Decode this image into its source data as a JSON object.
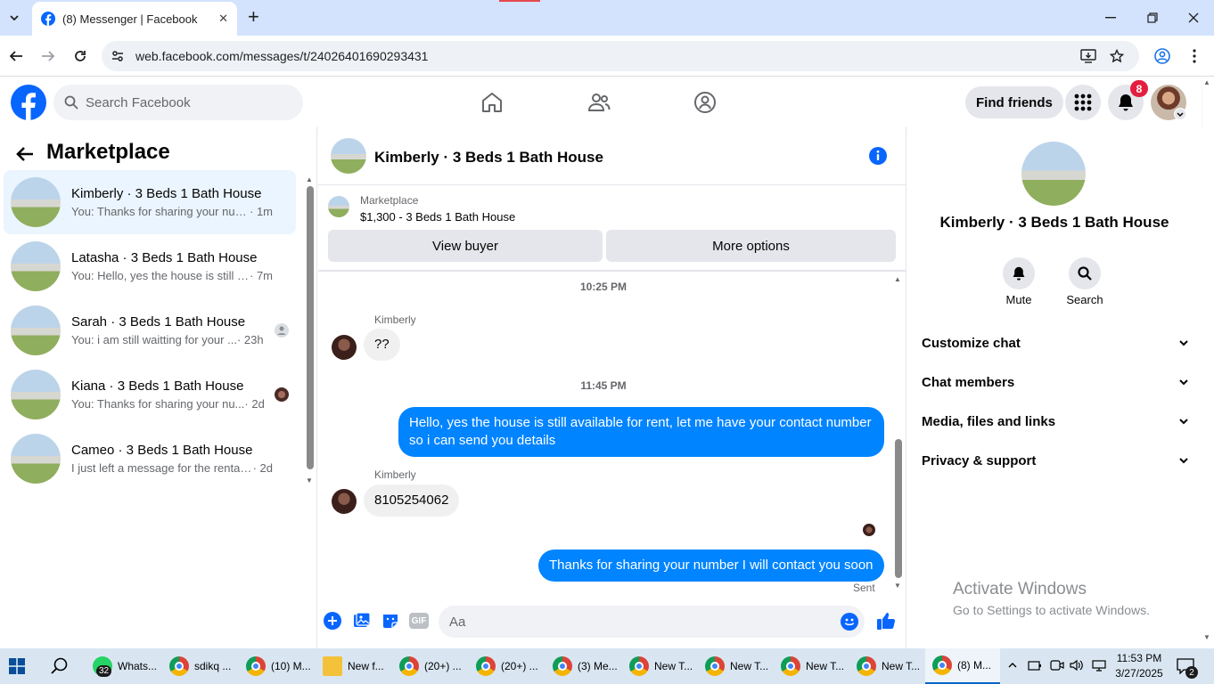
{
  "browser": {
    "tab_title": "(8) Messenger | Facebook",
    "url": "web.facebook.com/messages/t/24026401690293431",
    "new_tab_symbol": "+",
    "close_symbol": "✕"
  },
  "fb": {
    "search_placeholder": "Search Facebook",
    "find_friends": "Find friends",
    "notification_count": "8"
  },
  "left": {
    "title": "Marketplace",
    "conversations": [
      {
        "name": "Kimberly · 3 Beds 1 Bath House",
        "preview": "You: Thanks for sharing your numb...",
        "time": "· 1m"
      },
      {
        "name": "Latasha · 3 Beds 1 Bath House",
        "preview": "You: Hello, yes the house is still av...",
        "time": "· 7m"
      },
      {
        "name": "Sarah · 3 Beds 1 Bath House",
        "preview": "You: i am still waitting for your ...",
        "time": "· 23h"
      },
      {
        "name": "Kiana · 3 Beds 1 Bath House",
        "preview": "You: Thanks for sharing your nu...",
        "time": "· 2d"
      },
      {
        "name": "Cameo · 3 Beds 1 Bath House",
        "preview": "I just left a message for the rental c...",
        "time": "· 2d"
      }
    ]
  },
  "chat": {
    "header_name": "Kimberly · 3 Beds 1 Bath House",
    "listing_label": "Marketplace",
    "listing_title": "$1,300 - 3 Beds 1 Bath House",
    "view_buyer": "View buyer",
    "more_options": "More options",
    "messages": [
      {
        "time": "10:25 PM"
      },
      {
        "sender": "Kimberly",
        "text": "??"
      },
      {
        "time": "11:45 PM"
      },
      {
        "text": "Hello, yes the house is still available for rent, let me have your contact number so i can send you  details"
      },
      {
        "sender": "Kimberly",
        "text": "8105254062"
      },
      {
        "text": "Thanks for sharing your number I will contact you soon"
      }
    ],
    "sent_label": "Sent",
    "composer_placeholder": "Aa",
    "gif_label": "GIF"
  },
  "info": {
    "name": "Kimberly · 3 Beds 1 Bath House",
    "mute": "Mute",
    "search": "Search",
    "sections": [
      "Customize chat",
      "Chat members",
      "Media, files and links",
      "Privacy & support"
    ]
  },
  "watermark": {
    "title": "Activate Windows",
    "subtitle": "Go to Settings to activate Windows."
  },
  "taskbar": {
    "items": [
      "Whats...",
      "sdikq ...",
      "(10) M...",
      "New f...",
      "(20+) ...",
      "(20+) ...",
      "(3) Me...",
      "New T...",
      "New T...",
      "New T...",
      "New T...",
      "(8) M..."
    ],
    "whatsapp_badge": "32",
    "time": "11:53 PM",
    "date": "3/27/2025",
    "notification_badge": "2"
  },
  "colors": {
    "accent": "#0084ff",
    "fb_blue": "#0866ff",
    "badge_red": "#e41e3f",
    "tab_strip": "#d3e3fd"
  }
}
